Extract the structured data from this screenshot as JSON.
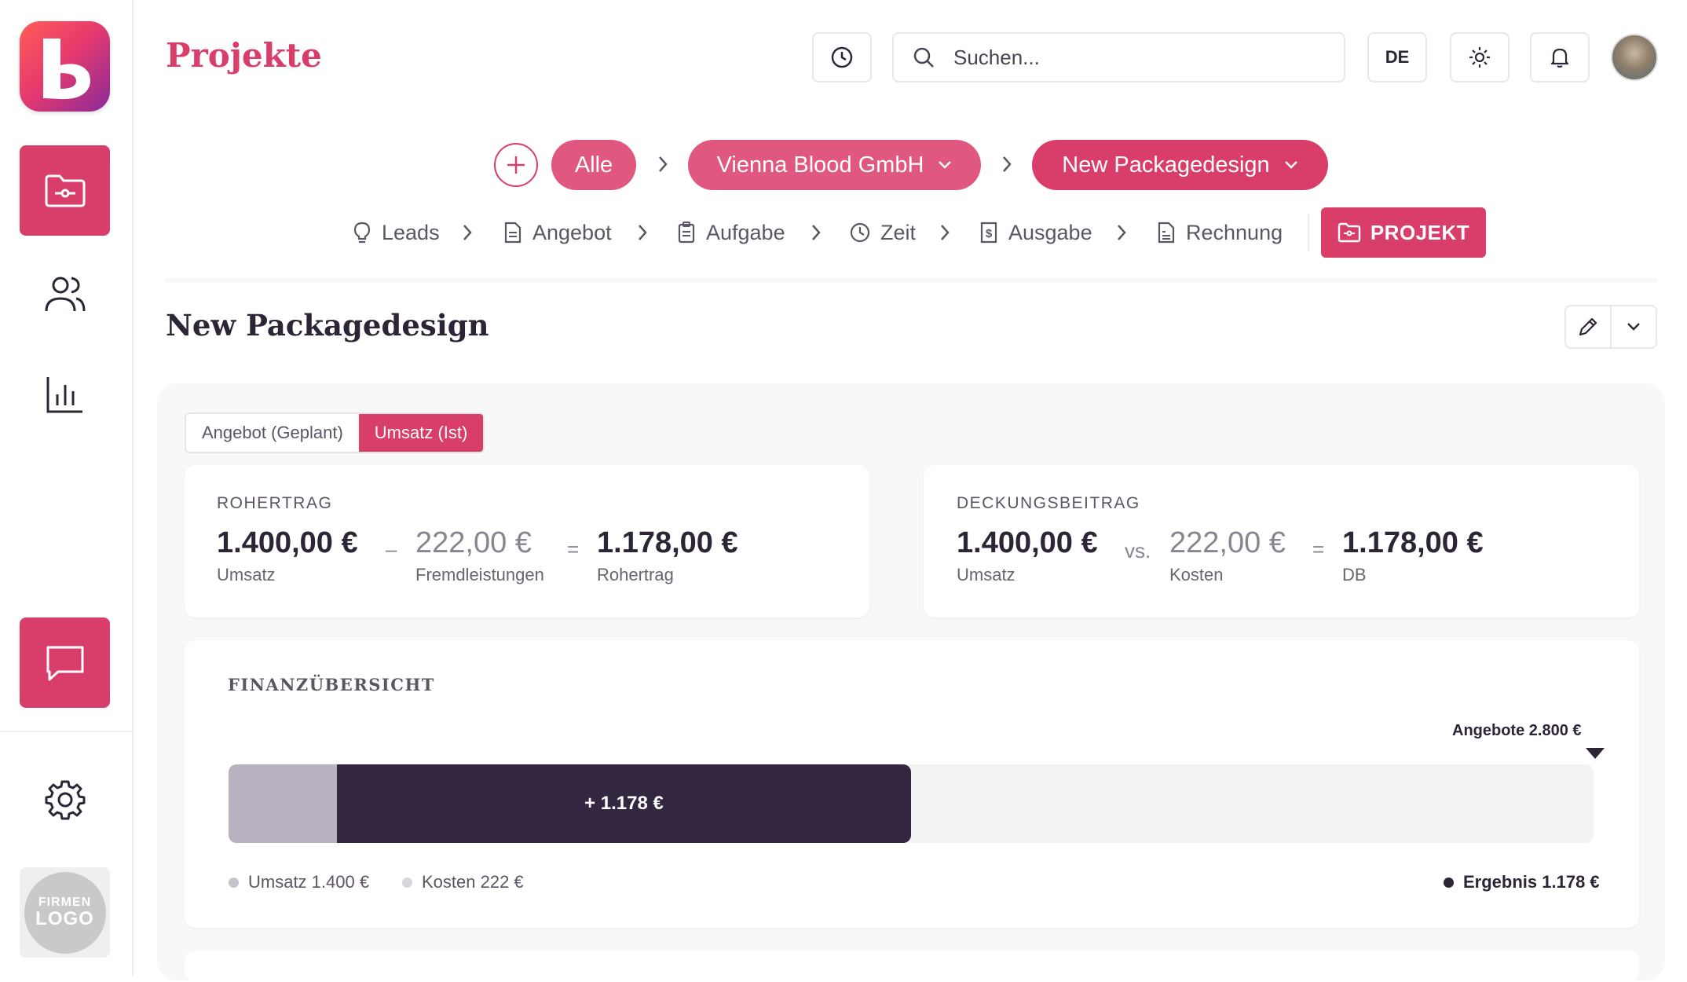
{
  "header": {
    "title": "Projekte",
    "search_placeholder": "Suchen...",
    "language": "DE"
  },
  "sidebar": {
    "items": [
      {
        "name": "projects",
        "icon": "folder-icon",
        "active": true
      },
      {
        "name": "contacts",
        "icon": "users-icon"
      },
      {
        "name": "reports",
        "icon": "bar-chart-icon"
      },
      {
        "name": "chat",
        "icon": "chat-icon"
      },
      {
        "name": "settings",
        "icon": "gear-icon"
      }
    ],
    "firm_logo": {
      "line1": "FIRMEN",
      "line2": "LOGO"
    }
  },
  "breadcrumb": {
    "all": "Alle",
    "client": "Vienna Blood GmbH",
    "project": "New Packagedesign"
  },
  "steps": [
    {
      "label": "Leads",
      "icon": "lightbulb-icon"
    },
    {
      "label": "Angebot",
      "icon": "document-icon"
    },
    {
      "label": "Aufgabe",
      "icon": "clipboard-icon"
    },
    {
      "label": "Zeit",
      "icon": "clock-icon"
    },
    {
      "label": "Ausgabe",
      "icon": "receipt-icon"
    },
    {
      "label": "Rechnung",
      "icon": "invoice-icon"
    }
  ],
  "projekt_button": "PROJEKT",
  "project": {
    "title": "New Packagedesign",
    "tabs": [
      {
        "label": "Angebot (Geplant)",
        "active": false
      },
      {
        "label": "Umsatz (Ist)",
        "active": true
      }
    ],
    "rohertrag": {
      "label": "ROHERTRAG",
      "umsatz": "1.400,00 €",
      "umsatz_label": "Umsatz",
      "op1": "–",
      "fremd": "222,00 €",
      "fremd_label": "Fremdleistungen",
      "op2": "=",
      "result": "1.178,00 €",
      "result_label": "Rohertrag"
    },
    "deckungsbeitrag": {
      "label": "DECKUNGSBEITRAG",
      "umsatz": "1.400,00 €",
      "umsatz_label": "Umsatz",
      "op1": "vs.",
      "kosten": "222,00 €",
      "kosten_label": "Kosten",
      "op2": "=",
      "result": "1.178,00 €",
      "result_label": "DB"
    },
    "finance": {
      "title": "FINANZÜBERSICHT",
      "angebote_label": "Angebote 2.800 €",
      "result_bar_label": "+ 1.178 €",
      "legend_umsatz": "Umsatz 1.400 €",
      "legend_kosten": "Kosten 222 €",
      "legend_result": "Ergebnis 1.178 €",
      "angebote": 2800,
      "umsatz": 1400,
      "kosten": 222,
      "ergebnis": 1178
    }
  },
  "colors": {
    "accent": "#d93d6a",
    "accent_light": "#e0587f",
    "dark": "#332640",
    "cost": "#b9b2c0"
  }
}
